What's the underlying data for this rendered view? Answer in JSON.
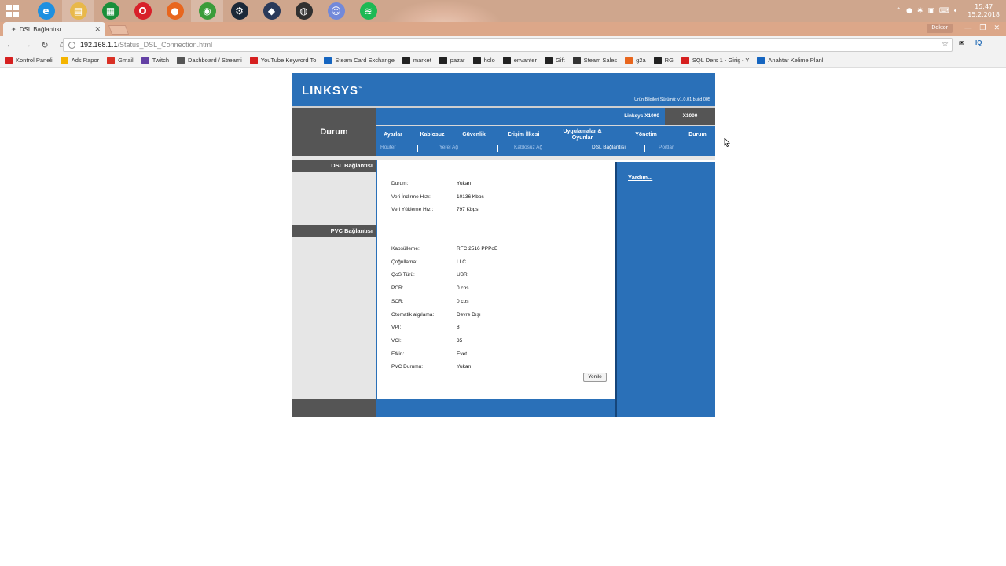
{
  "taskbar": {
    "apps": [
      {
        "name": "internet-explorer",
        "glyph": "e",
        "color": "#1e90e0"
      },
      {
        "name": "file-explorer",
        "glyph": "▤",
        "color": "#e8b84a"
      },
      {
        "name": "store",
        "glyph": "▦",
        "color": "#1a8f3a"
      },
      {
        "name": "opera",
        "glyph": "O",
        "color": "#d8202a"
      },
      {
        "name": "firefox",
        "glyph": "●",
        "color": "#e8661e"
      },
      {
        "name": "chrome",
        "glyph": "◉",
        "color": "#3a9c3a"
      },
      {
        "name": "steam",
        "glyph": "⚙",
        "color": "#1b2838"
      },
      {
        "name": "app-shield",
        "glyph": "◆",
        "color": "#2a3a5a"
      },
      {
        "name": "obs",
        "glyph": "◍",
        "color": "#303030"
      },
      {
        "name": "discord",
        "glyph": "☺",
        "color": "#7289da"
      },
      {
        "name": "spotify",
        "glyph": "≋",
        "color": "#1db954"
      }
    ],
    "time": "15:47",
    "date": "15.2.2018"
  },
  "browser": {
    "tab_title": "DSL Bağlantısı",
    "profile": "Doktor",
    "url_host": "192.168.1.1",
    "url_path": "/Status_DSL_Connection.html"
  },
  "bookmarks": [
    {
      "label": "Kontrol Paneli",
      "color": "#d62020"
    },
    {
      "label": "Ads Rapor",
      "color": "#f4b400"
    },
    {
      "label": "Gmail",
      "color": "#d93025"
    },
    {
      "label": "Twitch",
      "color": "#6441a5"
    },
    {
      "label": "Dashboard / Streami",
      "color": "#555555"
    },
    {
      "label": "YouTube Keyword To",
      "color": "#d62020"
    },
    {
      "label": "Steam Card Exchange",
      "color": "#1565c0"
    },
    {
      "label": "market",
      "color": "#222222"
    },
    {
      "label": "pazar",
      "color": "#222222"
    },
    {
      "label": "holo",
      "color": "#222222"
    },
    {
      "label": "envanter",
      "color": "#222222"
    },
    {
      "label": "Gift",
      "color": "#222222"
    },
    {
      "label": "Steam Sales",
      "color": "#333333"
    },
    {
      "label": "g2a",
      "color": "#e8661e"
    },
    {
      "label": "RG",
      "color": "#222222"
    },
    {
      "label": "SQL Ders 1 - Giriş - Y",
      "color": "#d62020"
    },
    {
      "label": "Anahtar Kelime Planl",
      "color": "#1565c0"
    }
  ],
  "router": {
    "logo": "LINKSYS",
    "version": "Ürün Bilgileri Sürümü: v1.0.01 build 005",
    "section": "Durum",
    "model_full": "Linksys X1000",
    "model_short": "X1000",
    "menu": [
      "Ayarlar",
      "Kablosuz",
      "Güvenlik",
      "Erişim İlkesi",
      "Uygulamalar & Oyunlar",
      "Yönetim",
      "Durum"
    ],
    "submenu": [
      "Router",
      "Yerel Ağ",
      "Kablosuz Ağ",
      "DSL Bağlantısı",
      "Portlar"
    ],
    "left_labels": [
      "DSL Bağlantısı",
      "PVC Bağlantısı"
    ],
    "help": "Yardım...",
    "refresh": "Yenile",
    "dsl": [
      {
        "label": "Durum:",
        "value": "Yukarı"
      },
      {
        "label": "Veri İndirme Hızı:",
        "value": "10136 Kbps"
      },
      {
        "label": "Veri Yükleme Hızı:",
        "value": "797 Kbps"
      }
    ],
    "pvc": [
      {
        "label": "Kapsülleme:",
        "value": "RFC 2516 PPPoE"
      },
      {
        "label": "Çoğullama:",
        "value": "LLC"
      },
      {
        "label": "QoS Türü:",
        "value": "UBR"
      },
      {
        "label": "PCR:",
        "value": "0 cps"
      },
      {
        "label": "SCR:",
        "value": "0 cps"
      },
      {
        "label": "Otomatik algılama:",
        "value": "Devre Dışı"
      },
      {
        "label": "VPI:",
        "value": "8"
      },
      {
        "label": "VCI:",
        "value": "35"
      },
      {
        "label": "Etkin:",
        "value": "Evet"
      },
      {
        "label": "PVC Durumu:",
        "value": "Yukarı"
      }
    ]
  }
}
